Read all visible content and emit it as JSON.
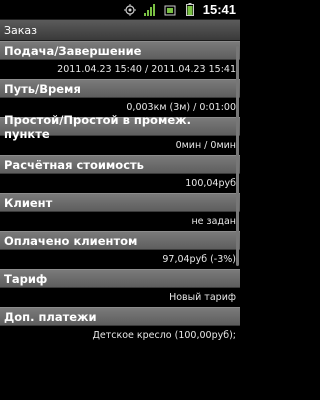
{
  "status_bar": {
    "time": "15:41",
    "icons": [
      "target-icon",
      "signal-bars-icon",
      "notification-icon",
      "battery-icon"
    ]
  },
  "window": {
    "title": "Заказ"
  },
  "sections": [
    {
      "header": "Подача/Завершение",
      "value": "2011.04.23 15:40 / 2011.04.23 15:41"
    },
    {
      "header": "Путь/Время",
      "value": "0,003км (3м) / 0:01:00"
    },
    {
      "header": "Простой/Простой в промеж. пункте",
      "value": "0мин / 0мин"
    },
    {
      "header": "Расчётная стоимость",
      "value": "100,04руб"
    },
    {
      "header": "Клиент",
      "value": "не задан"
    },
    {
      "header": "Оплачено клиентом",
      "value": "97,04руб (-3%)"
    },
    {
      "header": "Тариф",
      "value": "Новый тариф"
    },
    {
      "header": "Доп. платежи",
      "value": "Детское кресло (100,00руб);"
    }
  ],
  "colors": {
    "accent_green": "#7ac143",
    "header_gray": "#6b6b6b"
  }
}
